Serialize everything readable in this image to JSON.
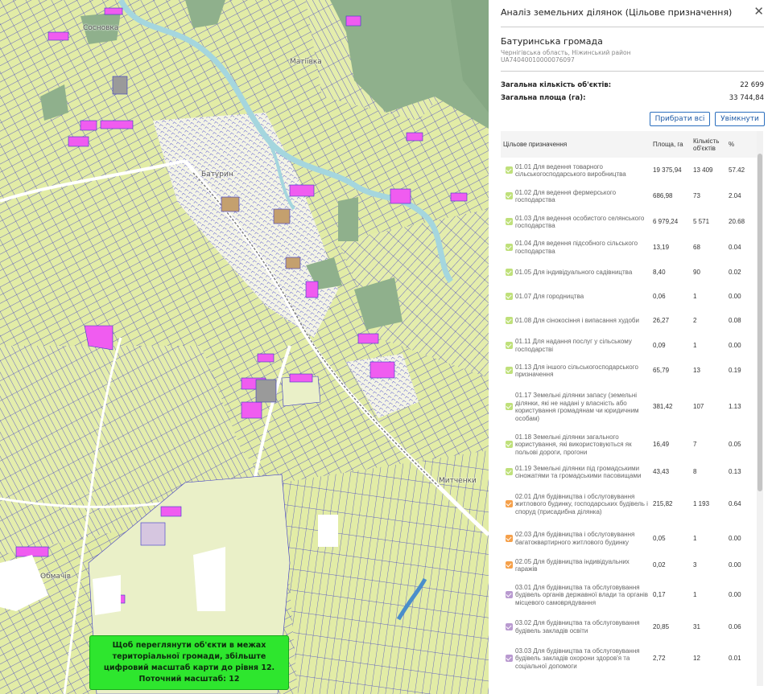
{
  "map": {
    "labels": {
      "sosnivka": "Сосновка",
      "matiivka": "Матіївка",
      "baturyn": "Батурин",
      "mytchenky": "Митченки",
      "obmachiv": "Обмачів"
    },
    "notice": {
      "line1": "Щоб переглянути об'єкти в межах",
      "line2": "територіальної громади, збільште",
      "line3": "цифровий масштаб карти до рівня 12.",
      "line4": "Поточний масштаб: 12"
    },
    "colors": {
      "background": "#eef2d2",
      "parcel_fill": "#e2eca6",
      "parcel_outline": "#3a37c8",
      "highlight": "#f05cf0",
      "forest": "#8fb08c",
      "river": "#a5d6de",
      "road": "#ffffff",
      "notice_bg": "#2ee62e"
    }
  },
  "panel": {
    "title": "Аналіз земельних ділянок (Цільове призначення)",
    "close_icon": "close-icon",
    "hromada": {
      "name": "Батуринська громада",
      "region": "Чернігівська область, Ніжинський район",
      "code": "UA74040010000076097"
    },
    "stats": {
      "count_label": "Загальна кількість об'єктів:",
      "count_value": "22 699",
      "area_label": "Загальна площа (га):",
      "area_value": "33 744,84"
    },
    "buttons": {
      "clear": "Прибрати всі",
      "enable": "Увімкнути"
    },
    "table": {
      "headers": {
        "purpose": "Цільове призначення",
        "area": "Площа, га",
        "count": "Кількість об'єктів",
        "pct": "%"
      },
      "rows": [
        {
          "name": "01.01 Для ведення товарного сільськогосподарського виробництва",
          "area": "19 375,94",
          "count": "13 409",
          "pct": "57.42",
          "color": "#bfe07a"
        },
        {
          "name": "01.02 Для ведення фермерського господарства",
          "area": "686,98",
          "count": "73",
          "pct": "2.04",
          "color": "#bfe07a"
        },
        {
          "name": "01.03 Для ведення особистого селянського господарства",
          "area": "6 979,24",
          "count": "5 571",
          "pct": "20.68",
          "color": "#bfe07a"
        },
        {
          "name": "01.04 Для ведення підсобного сільського господарства",
          "area": "13,19",
          "count": "68",
          "pct": "0.04",
          "color": "#bfe07a"
        },
        {
          "name": "01.05 Для індивідуального садівництва",
          "area": "8,40",
          "count": "90",
          "pct": "0.02",
          "color": "#bfe07a"
        },
        {
          "name": "01.07 Для городництва",
          "area": "0,06",
          "count": "1",
          "pct": "0.00",
          "color": "#bfe07a"
        },
        {
          "name": "01.08 Для сінокосіння і випасання худоби",
          "area": "26,27",
          "count": "2",
          "pct": "0.08",
          "color": "#bfe07a"
        },
        {
          "name": "01.11 Для надання послуг у сільському господарстві",
          "area": "0,09",
          "count": "1",
          "pct": "0.00",
          "color": "#bfe07a"
        },
        {
          "name": "01.13 Для іншого сільськогосподарського призначення",
          "area": "65,79",
          "count": "13",
          "pct": "0.19",
          "color": "#bfe07a"
        },
        {
          "name": "01.17 Земельні ділянки запасу (земельні ділянки, які не надані у власність або користування громадянам чи юридичним особам)",
          "area": "381,42",
          "count": "107",
          "pct": "1.13",
          "color": "#bfe07a"
        },
        {
          "name": "01.18 Земельні ділянки загального користування, які використовуються як польові дороги, прогони",
          "area": "16,49",
          "count": "7",
          "pct": "0.05",
          "color": "#bfe07a"
        },
        {
          "name": "01.19 Земельні ділянки під громадськими сіножатями та громадськими пасовищами",
          "area": "43,43",
          "count": "8",
          "pct": "0.13",
          "color": "#bfe07a"
        },
        {
          "name": "02.01 Для будівництва і обслуговування житлового будинку, господарських будівель і споруд (присадибна ділянка)",
          "area": "215,82",
          "count": "1 193",
          "pct": "0.64",
          "color": "#f5a04a"
        },
        {
          "name": "02.03 Для будівництва і обслуговування багатоквартирного житлового будинку",
          "area": "0,05",
          "count": "1",
          "pct": "0.00",
          "color": "#f5a04a"
        },
        {
          "name": "02.05 Для будівництва індивідуальних гаражів",
          "area": "0,02",
          "count": "3",
          "pct": "0.00",
          "color": "#f5a04a"
        },
        {
          "name": "03.01 Для будівництва та обслуговування будівель органів державної влади та органів місцевого самоврядування",
          "area": "0,17",
          "count": "1",
          "pct": "0.00",
          "color": "#b99ad0"
        },
        {
          "name": "03.02 Для будівництва та обслуговування будівель закладів освіти",
          "area": "20,85",
          "count": "31",
          "pct": "0.06",
          "color": "#b99ad0"
        },
        {
          "name": "03.03 Для будівництва та обслуговування будівель закладів охорони здоров'я та соціальної допомоги",
          "area": "2,72",
          "count": "12",
          "pct": "0.01",
          "color": "#b99ad0"
        }
      ]
    }
  }
}
